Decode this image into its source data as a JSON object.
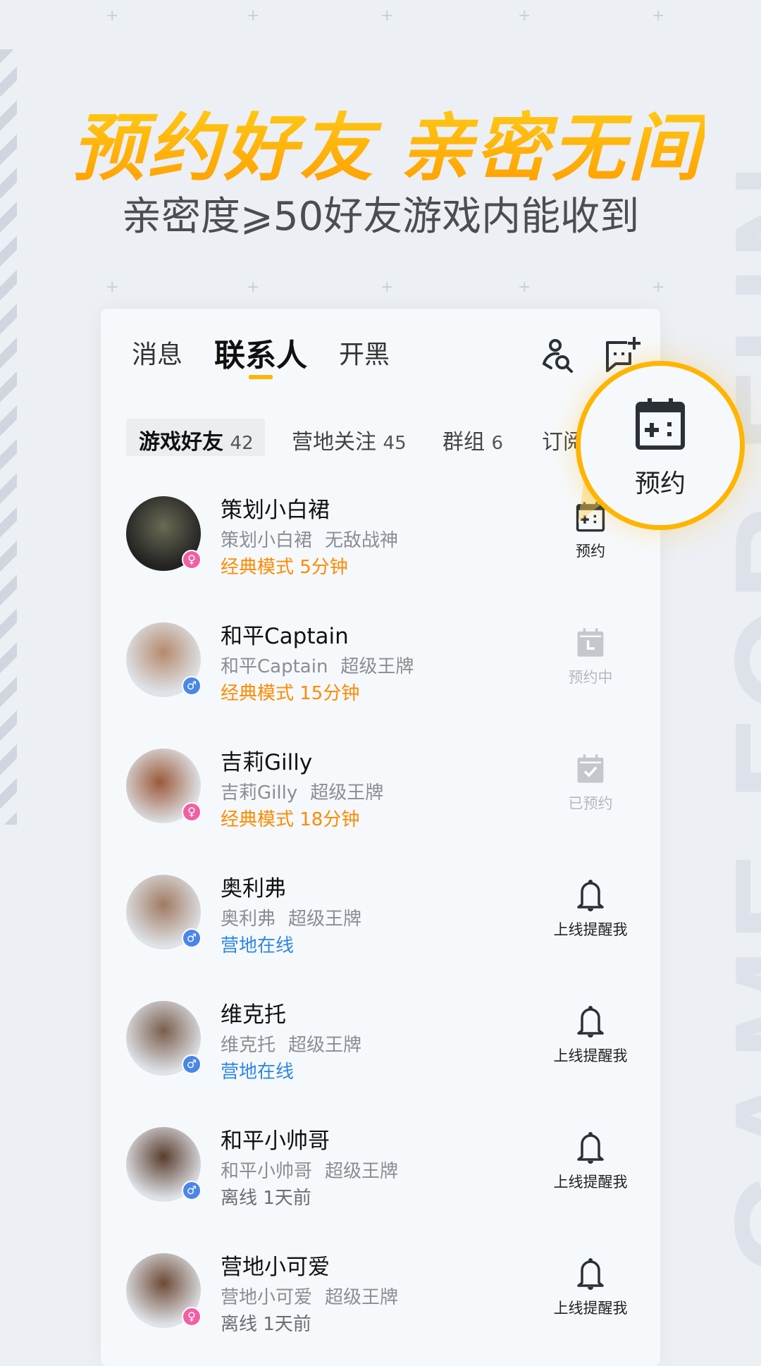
{
  "promo": {
    "headline": "预约好友 亲密无间",
    "subhead": "亲密度⩾50好友游戏内能收到",
    "bg_word": "GAME FOR FUN"
  },
  "colors": {
    "accent": "#ffb400",
    "orange_text": "#ff8a00",
    "blue_text": "#2f86e6",
    "female": "#f060a4",
    "male": "#4a86e8"
  },
  "top_tabs": [
    {
      "label": "消息"
    },
    {
      "label": "联系人",
      "active": true
    },
    {
      "label": "开黑"
    }
  ],
  "header_icons": [
    "search-friend-icon",
    "add-chat-icon"
  ],
  "sub_tabs": [
    {
      "label": "游戏好友",
      "count": "42",
      "active": true
    },
    {
      "label": "营地关注",
      "count": "45"
    },
    {
      "label": "群组",
      "count": "6"
    },
    {
      "label": "订阅"
    }
  ],
  "callout": {
    "icon": "calendar-gamepad-icon",
    "label": "预约"
  },
  "contacts": [
    {
      "name": "策划小白裙",
      "nick": "策划小白裙",
      "rank": "无敌战神",
      "status": "经典模式 5分钟",
      "status_type": "orange",
      "gender": "female",
      "action": "预约",
      "action_state": "available"
    },
    {
      "name": "和平Captain",
      "nick": "和平Captain",
      "rank": "超级王牌",
      "status": "经典模式 15分钟",
      "status_type": "orange",
      "gender": "male",
      "action": "预约中",
      "action_state": "pending"
    },
    {
      "name": "吉莉Gilly",
      "nick": "吉莉Gilly",
      "rank": "超级王牌",
      "status": "经典模式 18分钟",
      "status_type": "orange",
      "gender": "female",
      "action": "已预约",
      "action_state": "done"
    },
    {
      "name": "奥利弗",
      "nick": "奥利弗",
      "rank": "超级王牌",
      "status": "营地在线",
      "status_type": "blue",
      "gender": "male",
      "action": "上线提醒我",
      "action_state": "bell"
    },
    {
      "name": "维克托",
      "nick": "维克托",
      "rank": "超级王牌",
      "status": "营地在线",
      "status_type": "blue",
      "gender": "male",
      "action": "上线提醒我",
      "action_state": "bell"
    },
    {
      "name": "和平小帅哥",
      "nick": "和平小帅哥",
      "rank": "超级王牌",
      "status": "离线  1天前",
      "status_type": "gray",
      "gender": "male",
      "action": "上线提醒我",
      "action_state": "bell"
    },
    {
      "name": "营地小可爱",
      "nick": "营地小可爱",
      "rank": "超级王牌",
      "status": "离线  1天前",
      "status_type": "gray",
      "gender": "female",
      "action": "上线提醒我",
      "action_state": "bell"
    }
  ]
}
